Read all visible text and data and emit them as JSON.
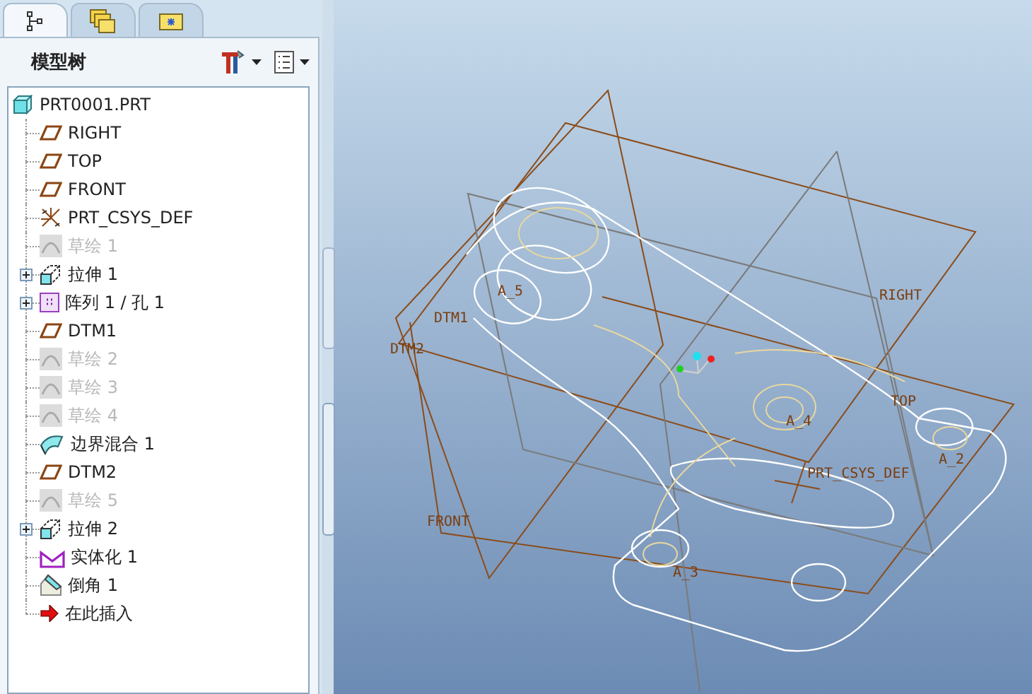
{
  "tabs": [
    {
      "kind": "tree",
      "selected": true
    },
    {
      "kind": "layers",
      "selected": false
    },
    {
      "kind": "folder",
      "selected": false
    }
  ],
  "panel": {
    "title": "模型树"
  },
  "tree": {
    "root": {
      "label": "PRT0001.PRT",
      "kind": "part"
    },
    "items": [
      {
        "label": "RIGHT",
        "kind": "plane",
        "disabled": false,
        "has_children": false
      },
      {
        "label": "TOP",
        "kind": "plane",
        "disabled": false,
        "has_children": false
      },
      {
        "label": "FRONT",
        "kind": "plane",
        "disabled": false,
        "has_children": false
      },
      {
        "label": "PRT_CSYS_DEF",
        "kind": "csys",
        "disabled": false,
        "has_children": false
      },
      {
        "label": "草绘 1",
        "kind": "sketch",
        "disabled": true,
        "has_children": false
      },
      {
        "label": "拉伸 1",
        "kind": "extrude",
        "disabled": false,
        "has_children": true
      },
      {
        "label": "阵列 1 / 孔 1",
        "kind": "pattern",
        "disabled": false,
        "has_children": true
      },
      {
        "label": "DTM1",
        "kind": "plane",
        "disabled": false,
        "has_children": false
      },
      {
        "label": "草绘 2",
        "kind": "sketch",
        "disabled": true,
        "has_children": false
      },
      {
        "label": "草绘 3",
        "kind": "sketch",
        "disabled": true,
        "has_children": false
      },
      {
        "label": "草绘 4",
        "kind": "sketch",
        "disabled": true,
        "has_children": false
      },
      {
        "label": "边界混合 1",
        "kind": "blend",
        "disabled": false,
        "has_children": false
      },
      {
        "label": "DTM2",
        "kind": "plane",
        "disabled": false,
        "has_children": false
      },
      {
        "label": "草绘 5",
        "kind": "sketch",
        "disabled": true,
        "has_children": false
      },
      {
        "label": "拉伸 2",
        "kind": "extrude",
        "disabled": false,
        "has_children": true
      },
      {
        "label": "实体化 1",
        "kind": "solidify",
        "disabled": false,
        "has_children": false
      },
      {
        "label": "倒角 1",
        "kind": "chamfer",
        "disabled": false,
        "has_children": false
      },
      {
        "label": "在此插入",
        "kind": "insert",
        "disabled": false,
        "has_children": false
      }
    ]
  },
  "viewport": {
    "labels": [
      "RIGHT",
      "TOP",
      "FRONT",
      "DTM1",
      "DTM2",
      "PRT_CSYS_DEF",
      "A_5",
      "A_4",
      "A_3",
      "A_2"
    ]
  }
}
